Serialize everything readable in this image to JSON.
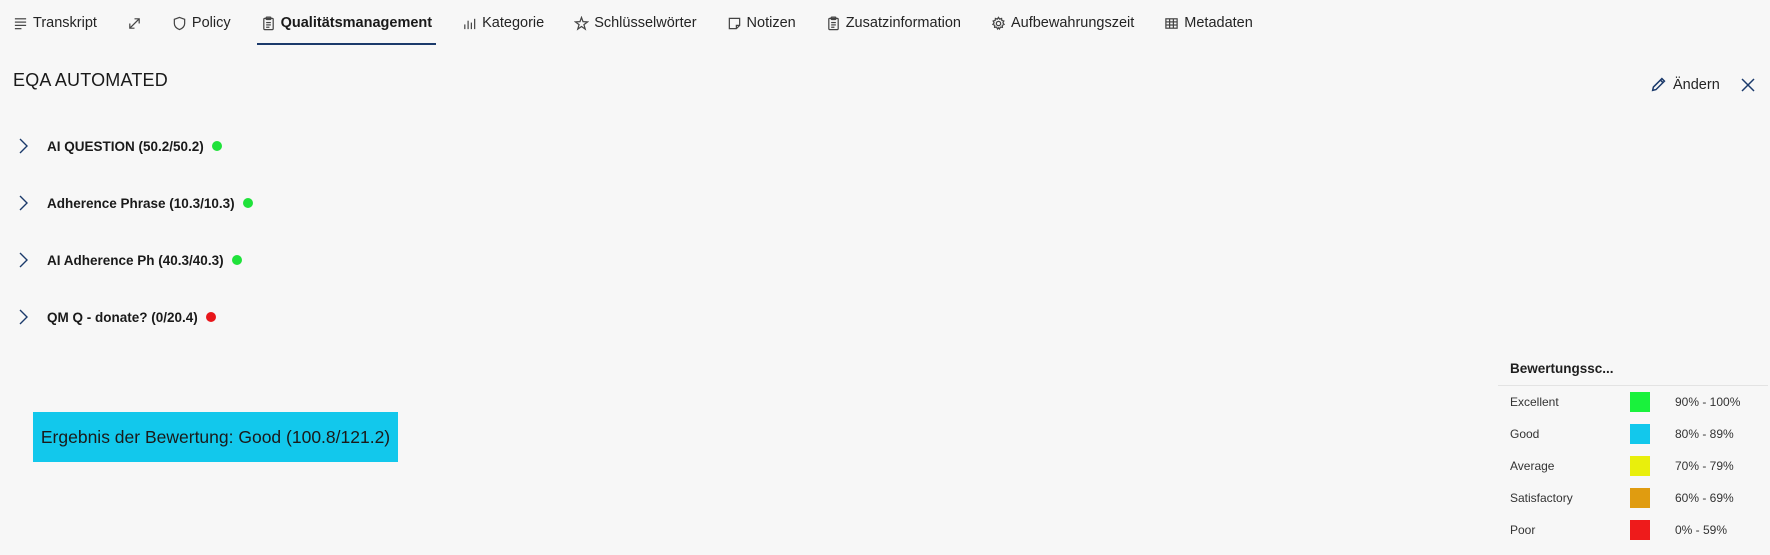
{
  "tabs": [
    {
      "label": "Transkript",
      "icon": "text-lines-icon"
    },
    {
      "label": "",
      "icon": "expand-icon"
    },
    {
      "label": "Policy",
      "icon": "shield-icon"
    },
    {
      "label": "Qualitätsmanagement",
      "icon": "clipboard-icon",
      "active": true
    },
    {
      "label": "Kategorie",
      "icon": "bar-chart-icon"
    },
    {
      "label": "Schlüsselwörter",
      "icon": "sparkle-icon"
    },
    {
      "label": "Notizen",
      "icon": "note-icon"
    },
    {
      "label": "Zusatzinformation",
      "icon": "clipboard-icon"
    },
    {
      "label": "Aufbewahrungszeit",
      "icon": "gear-icon"
    },
    {
      "label": "Metadaten",
      "icon": "table-icon"
    }
  ],
  "header": {
    "title": "EQA AUTOMATED",
    "edit_label": "Ändern"
  },
  "questions": [
    {
      "label": "AI QUESTION (50.2/50.2)",
      "status_color": "#1fe23a"
    },
    {
      "label": "Adherence Phrase (10.3/10.3)",
      "status_color": "#1fe23a"
    },
    {
      "label": "AI Adherence Ph (40.3/40.3)",
      "status_color": "#1fe23a"
    },
    {
      "label": "QM Q - donate? (0/20.4)",
      "status_color": "#e8161b"
    }
  ],
  "result": {
    "label": "Ergebnis der Bewertung: Good (100.8/121.2)",
    "color": "#12c8ec"
  },
  "legend": {
    "title": "Bewertungssc...",
    "rows": [
      {
        "label": "Excellent",
        "color": "#19f23c",
        "range": "90% - 100%"
      },
      {
        "label": "Good",
        "color": "#12c8ec",
        "range": "80% - 89%"
      },
      {
        "label": "Average",
        "color": "#e9ef0c",
        "range": "70% - 79%"
      },
      {
        "label": "Satisfactory",
        "color": "#e09c10",
        "range": "60% - 69%"
      },
      {
        "label": "Poor",
        "color": "#ee1b1b",
        "range": "0% - 59%"
      }
    ]
  }
}
